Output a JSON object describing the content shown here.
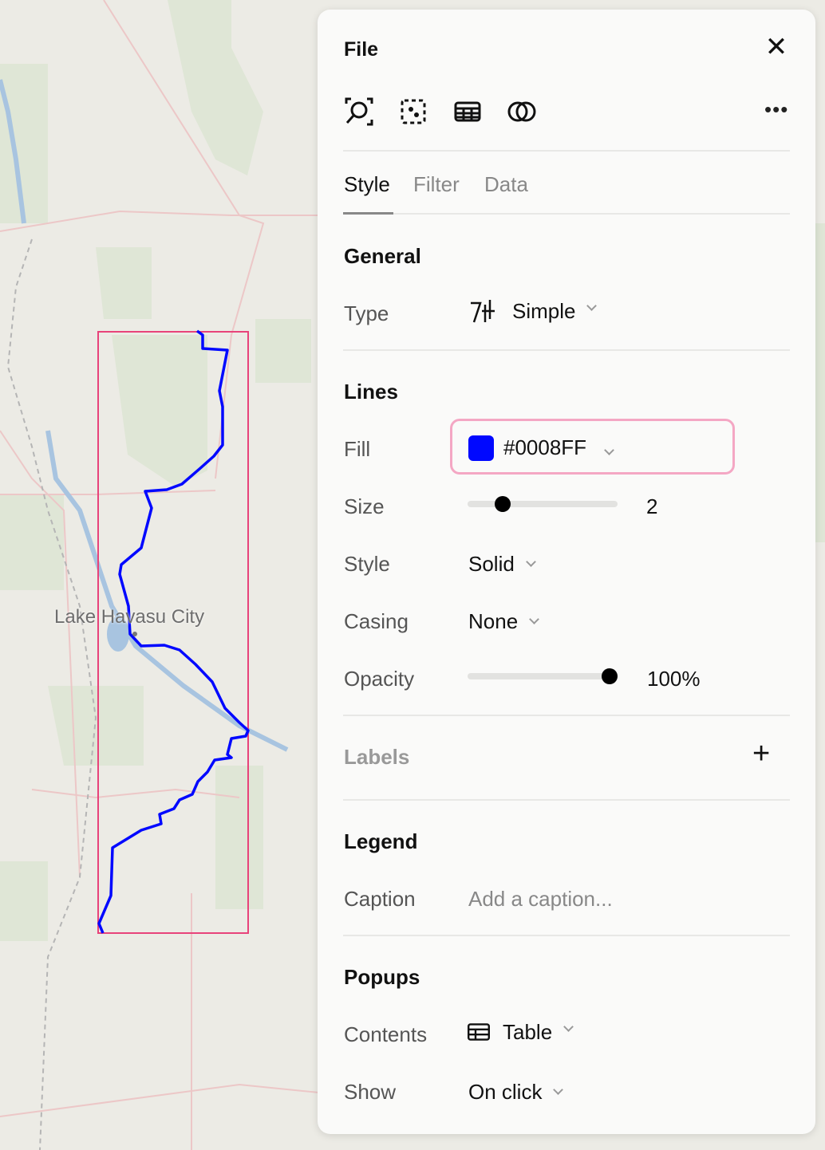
{
  "map": {
    "city_label": "Lake Havasu City",
    "route_color": "#0008FF",
    "bbox_color": "#e8437a"
  },
  "panel": {
    "title": "File",
    "toolbar": {
      "icons": [
        "zoom-to-fit-icon",
        "select-features-icon",
        "table-icon",
        "blend-icon",
        "more-icon"
      ]
    },
    "tabs": [
      {
        "label": "Style",
        "active": true
      },
      {
        "label": "Filter"
      },
      {
        "label": "Data"
      }
    ],
    "general": {
      "heading": "General",
      "type_label": "Type",
      "type_value": "Simple"
    },
    "lines": {
      "heading": "Lines",
      "fill_label": "Fill",
      "fill_value": "#0008FF",
      "size_label": "Size",
      "size_value": "2",
      "style_label": "Style",
      "style_value": "Solid",
      "casing_label": "Casing",
      "casing_value": "None",
      "opacity_label": "Opacity",
      "opacity_value": "100%",
      "opacity_fraction": 1.0
    },
    "labels": {
      "heading": "Labels"
    },
    "legend": {
      "heading": "Legend",
      "caption_label": "Caption",
      "caption_placeholder": "Add a caption..."
    },
    "popups": {
      "heading": "Popups",
      "contents_label": "Contents",
      "contents_value": "Table",
      "show_label": "Show",
      "show_value": "On click"
    }
  }
}
